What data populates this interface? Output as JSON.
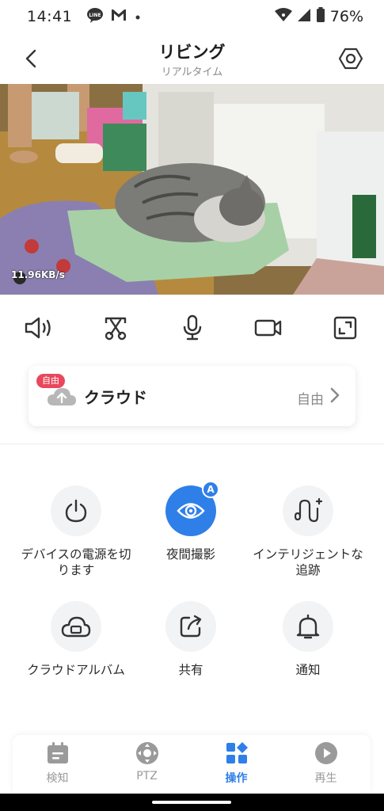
{
  "status_bar": {
    "time": "14:41",
    "battery": "76%",
    "app_icons": [
      "line-icon",
      "gmail-icon",
      "dot-icon"
    ]
  },
  "header": {
    "title": "リビング",
    "subtitle": "リアルタイム",
    "back_icon": "back-arrow-icon",
    "settings_icon": "settings-hexagon-icon"
  },
  "video": {
    "bitrate": "11.96KB/s"
  },
  "toolbar": [
    {
      "name": "speaker-icon"
    },
    {
      "name": "screenshot-scissors-icon"
    },
    {
      "name": "microphone-icon"
    },
    {
      "name": "record-video-icon"
    },
    {
      "name": "fullscreen-icon"
    }
  ],
  "cloud": {
    "badge": "自由",
    "label": "クラウド",
    "status": "自由"
  },
  "features": [
    {
      "label": "デバイスの電源を切ります",
      "icon": "power-icon",
      "active": false
    },
    {
      "label": "夜間撮影",
      "icon": "eye-icon",
      "active": true,
      "badge": "A"
    },
    {
      "label": "インテリジェントな追跡",
      "icon": "tracking-icon",
      "active": false
    },
    {
      "label": "クラウドアルバム",
      "icon": "cloud-album-icon",
      "active": false
    },
    {
      "label": "共有",
      "icon": "share-icon",
      "active": false
    },
    {
      "label": "通知",
      "icon": "bell-icon",
      "active": false
    }
  ],
  "bottom_nav": [
    {
      "label": "検知",
      "icon": "calendar-icon",
      "active": false
    },
    {
      "label": "PTZ",
      "icon": "ptz-icon",
      "active": false
    },
    {
      "label": "操作",
      "icon": "operation-grid-icon",
      "active": true
    },
    {
      "label": "再生",
      "icon": "play-icon",
      "active": false
    }
  ],
  "colors": {
    "accent": "#2f7fe8",
    "badge_red": "#e9475c",
    "icon_dark": "#333333",
    "inactive_gray": "#9a9a9a"
  }
}
